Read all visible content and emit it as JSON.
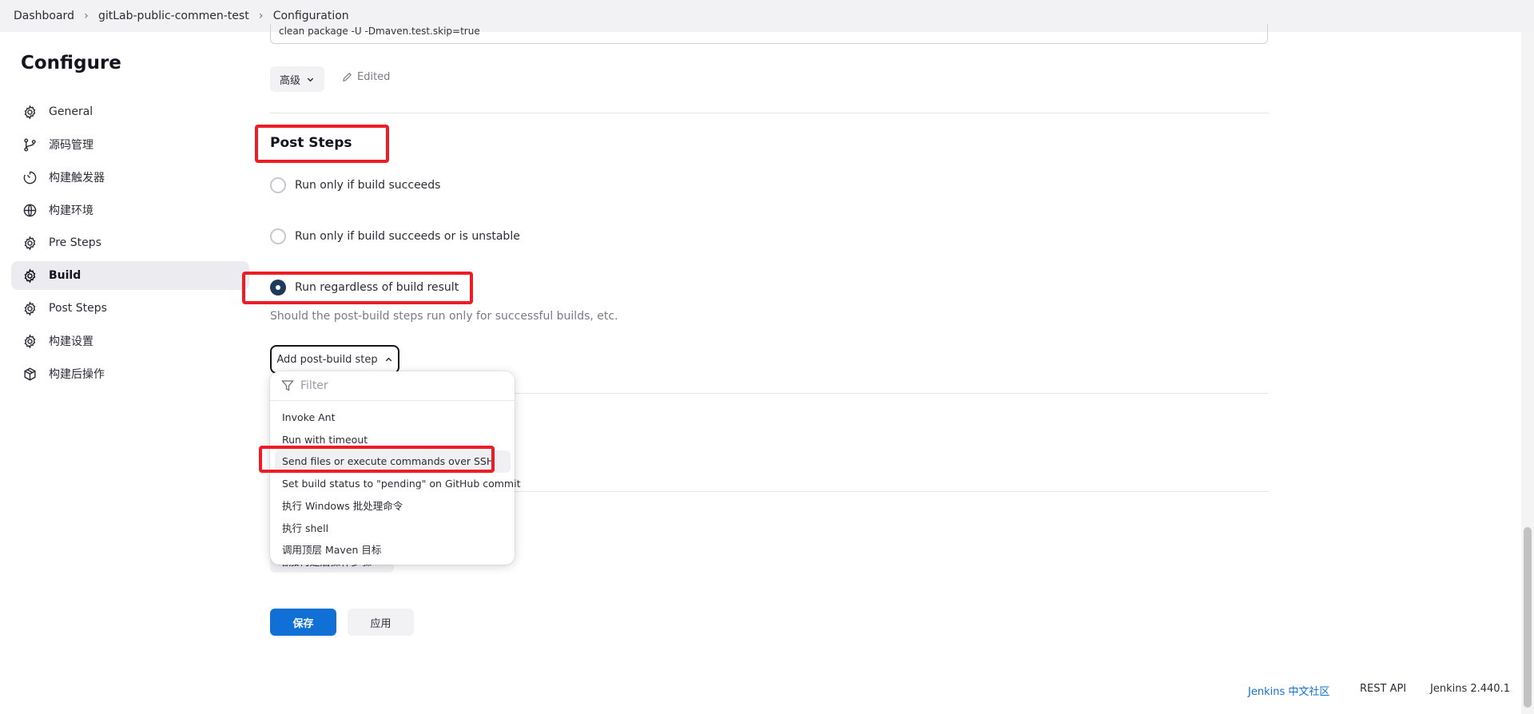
{
  "breadcrumb": {
    "items": [
      "Dashboard",
      "gitLab-public-commen-test",
      "Configuration"
    ],
    "separator": "›"
  },
  "sidebar": {
    "title": "Configure",
    "items": [
      {
        "label": "General",
        "icon": "gear-icon"
      },
      {
        "label": "源码管理",
        "icon": "source-branch-icon"
      },
      {
        "label": "构建触发器",
        "icon": "timer-icon"
      },
      {
        "label": "构建环境",
        "icon": "globe-icon"
      },
      {
        "label": "Pre Steps",
        "icon": "gear-icon"
      },
      {
        "label": "Build",
        "icon": "gear-icon",
        "active": true
      },
      {
        "label": "Post Steps",
        "icon": "gear-icon"
      },
      {
        "label": "构建设置",
        "icon": "gear-icon"
      },
      {
        "label": "构建后操作",
        "icon": "cube-icon"
      }
    ]
  },
  "main": {
    "previous_goal_value": "clean package -U -Dmaven.test.skip=true",
    "advanced_button": "高级",
    "edited_label": "Edited",
    "post_steps": {
      "title": "Post Steps",
      "options": [
        {
          "label": "Run only if build succeeds",
          "checked": false
        },
        {
          "label": "Run only if build succeeds or is unstable",
          "checked": false
        },
        {
          "label": "Run regardless of build result",
          "checked": true
        }
      ],
      "help": "Should the post-build steps run only for successful builds, etc.",
      "add_button": "Add post-build step"
    },
    "hidden_button": "增加构建后操作步骤",
    "save_button": "保存",
    "apply_button": "应用"
  },
  "dropdown": {
    "filter_placeholder": "Filter",
    "items": [
      "Invoke Ant",
      "Run with timeout",
      "Send files or execute commands over SSH",
      "Set build status to \"pending\" on GitHub commit",
      "执行 Windows 批处理命令",
      "执行 shell",
      "调用顶层 Maven 目标"
    ],
    "hovered_index": 2
  },
  "footer": {
    "community_link": "Jenkins 中文社区",
    "rest_api": "REST API",
    "version": "Jenkins 2.440.1"
  },
  "colors": {
    "accent": "#1170d6",
    "highlight": "#ee1c25",
    "radio_checked": "#1d3a5c"
  }
}
